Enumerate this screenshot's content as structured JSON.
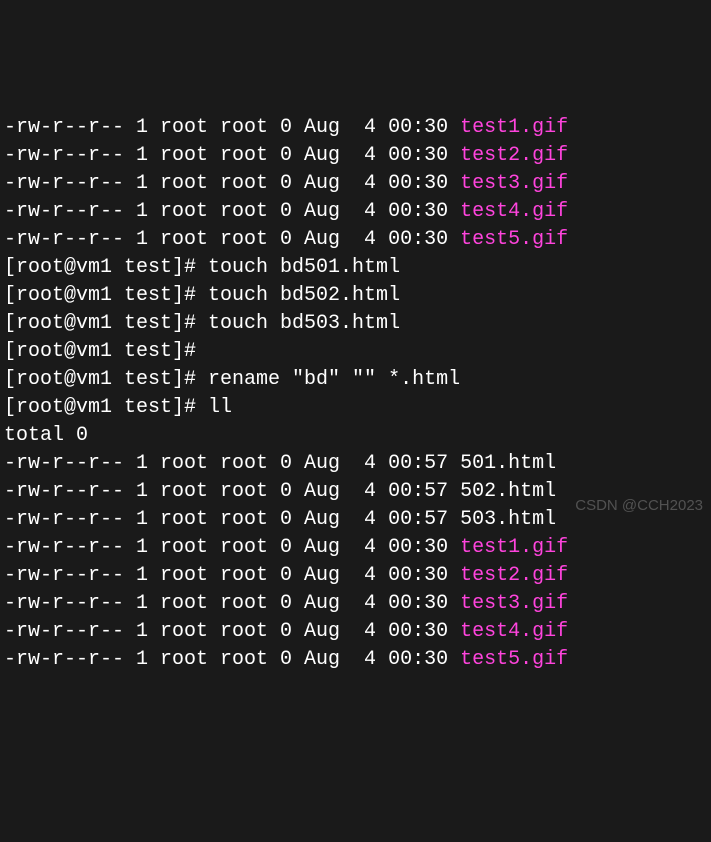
{
  "listing1": [
    {
      "perms": "-rw-r--r--",
      "links": "1",
      "owner": "root",
      "group": "root",
      "size": "0",
      "month": "Aug",
      "day": " 4",
      "time": "00:30",
      "filename": "test1.gif",
      "type": "gif"
    },
    {
      "perms": "-rw-r--r--",
      "links": "1",
      "owner": "root",
      "group": "root",
      "size": "0",
      "month": "Aug",
      "day": " 4",
      "time": "00:30",
      "filename": "test2.gif",
      "type": "gif"
    },
    {
      "perms": "-rw-r--r--",
      "links": "1",
      "owner": "root",
      "group": "root",
      "size": "0",
      "month": "Aug",
      "day": " 4",
      "time": "00:30",
      "filename": "test3.gif",
      "type": "gif"
    },
    {
      "perms": "-rw-r--r--",
      "links": "1",
      "owner": "root",
      "group": "root",
      "size": "0",
      "month": "Aug",
      "day": " 4",
      "time": "00:30",
      "filename": "test4.gif",
      "type": "gif"
    },
    {
      "perms": "-rw-r--r--",
      "links": "1",
      "owner": "root",
      "group": "root",
      "size": "0",
      "month": "Aug",
      "day": " 4",
      "time": "00:30",
      "filename": "test5.gif",
      "type": "gif"
    }
  ],
  "prompts": [
    {
      "prompt": "[root@vm1 test]#",
      "cmd": " touch bd501.html"
    },
    {
      "prompt": "[root@vm1 test]#",
      "cmd": " touch bd502.html"
    },
    {
      "prompt": "[root@vm1 test]#",
      "cmd": " touch bd503.html"
    },
    {
      "prompt": "[root@vm1 test]#",
      "cmd": ""
    },
    {
      "prompt": "[root@vm1 test]#",
      "cmd": " rename \"bd\" \"\" *.html"
    },
    {
      "prompt": "[root@vm1 test]#",
      "cmd": " ll"
    }
  ],
  "total_line": "total 0",
  "listing2": [
    {
      "perms": "-rw-r--r--",
      "links": "1",
      "owner": "root",
      "group": "root",
      "size": "0",
      "month": "Aug",
      "day": " 4",
      "time": "00:57",
      "filename": "501.html",
      "type": "html"
    },
    {
      "perms": "-rw-r--r--",
      "links": "1",
      "owner": "root",
      "group": "root",
      "size": "0",
      "month": "Aug",
      "day": " 4",
      "time": "00:57",
      "filename": "502.html",
      "type": "html"
    },
    {
      "perms": "-rw-r--r--",
      "links": "1",
      "owner": "root",
      "group": "root",
      "size": "0",
      "month": "Aug",
      "day": " 4",
      "time": "00:57",
      "filename": "503.html",
      "type": "html"
    },
    {
      "perms": "-rw-r--r--",
      "links": "1",
      "owner": "root",
      "group": "root",
      "size": "0",
      "month": "Aug",
      "day": " 4",
      "time": "00:30",
      "filename": "test1.gif",
      "type": "gif"
    },
    {
      "perms": "-rw-r--r--",
      "links": "1",
      "owner": "root",
      "group": "root",
      "size": "0",
      "month": "Aug",
      "day": " 4",
      "time": "00:30",
      "filename": "test2.gif",
      "type": "gif"
    },
    {
      "perms": "-rw-r--r--",
      "links": "1",
      "owner": "root",
      "group": "root",
      "size": "0",
      "month": "Aug",
      "day": " 4",
      "time": "00:30",
      "filename": "test3.gif",
      "type": "gif"
    },
    {
      "perms": "-rw-r--r--",
      "links": "1",
      "owner": "root",
      "group": "root",
      "size": "0",
      "month": "Aug",
      "day": " 4",
      "time": "00:30",
      "filename": "test4.gif",
      "type": "gif"
    },
    {
      "perms": "-rw-r--r--",
      "links": "1",
      "owner": "root",
      "group": "root",
      "size": "0",
      "month": "Aug",
      "day": " 4",
      "time": "00:30",
      "filename": "test5.gif",
      "type": "gif"
    }
  ],
  "watermark": "CSDN @CCH2023"
}
